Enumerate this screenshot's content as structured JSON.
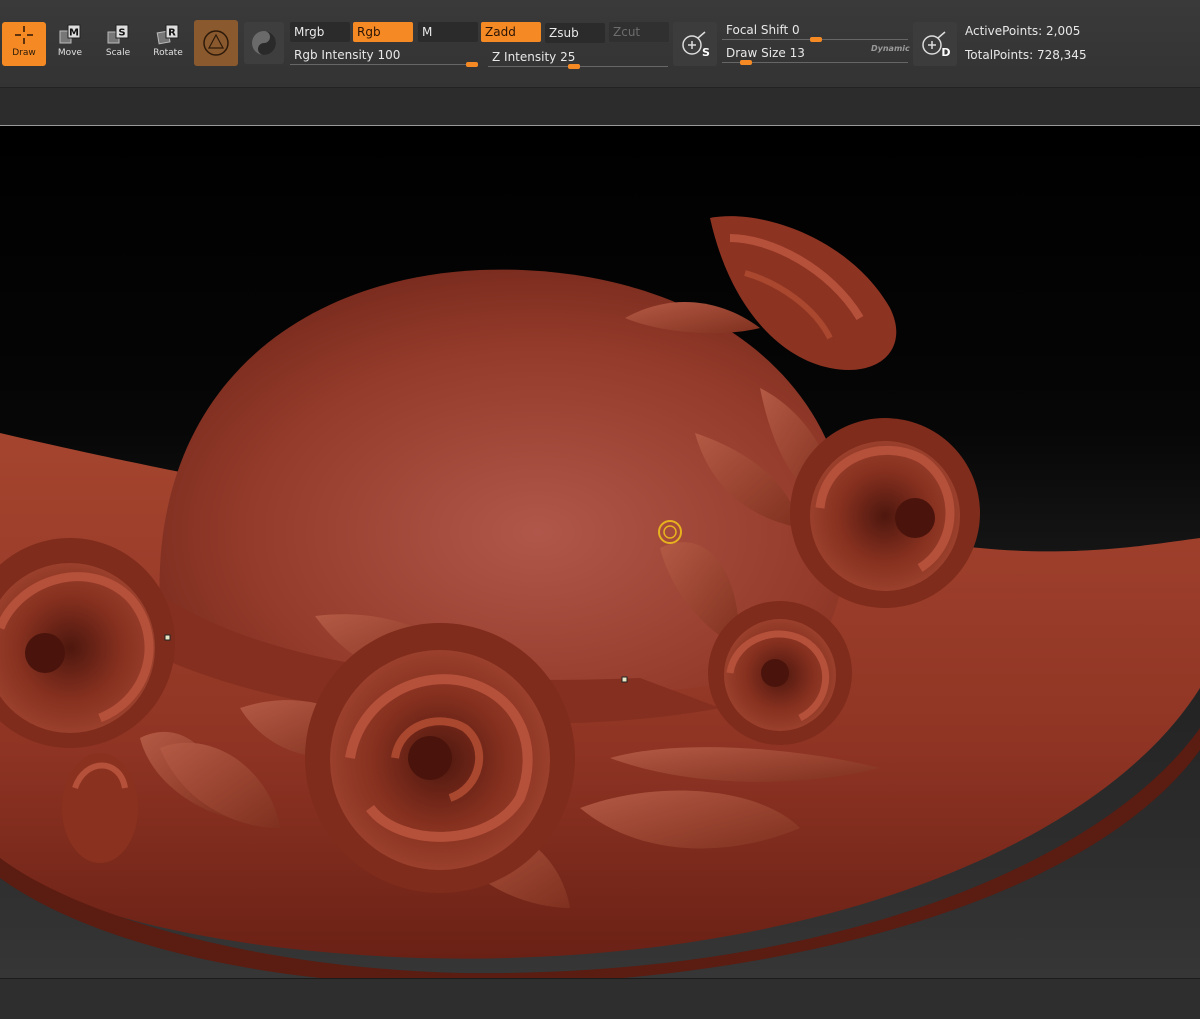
{
  "tools": [
    {
      "key": "draw",
      "label": "Draw",
      "letter": "",
      "active": true
    },
    {
      "key": "move",
      "label": "Move",
      "letter": "M",
      "active": false
    },
    {
      "key": "scale",
      "label": "Scale",
      "letter": "S",
      "active": false
    },
    {
      "key": "rotate",
      "label": "Rotate",
      "letter": "R",
      "active": false
    }
  ],
  "modes": {
    "mrgb": "Mrgb",
    "rgb": "Rgb",
    "m": "M",
    "zadd": "Zadd",
    "zsub": "Zsub",
    "zcut": "Zcut"
  },
  "sliders": {
    "rgb_intensity_label": "Rgb Intensity",
    "rgb_intensity": 100,
    "z_intensity_label": "Z Intensity",
    "z_intensity": 25,
    "focal_shift_label": "Focal Shift",
    "focal_shift": 0,
    "draw_size_label": "Draw Size",
    "draw_size": 13,
    "dynamic_label": "Dynamic"
  },
  "buttons": {
    "sdiv_letter": "S",
    "dyn_letter": "D"
  },
  "stats": {
    "active_points_label": "ActivePoints:",
    "active_points": "2,005",
    "total_points_label": "TotalPoints:",
    "total_points": "728,345"
  },
  "colors": {
    "accent": "#f58a25",
    "clay": "#9a3e2c",
    "brush_ring": "#e7b21e"
  }
}
